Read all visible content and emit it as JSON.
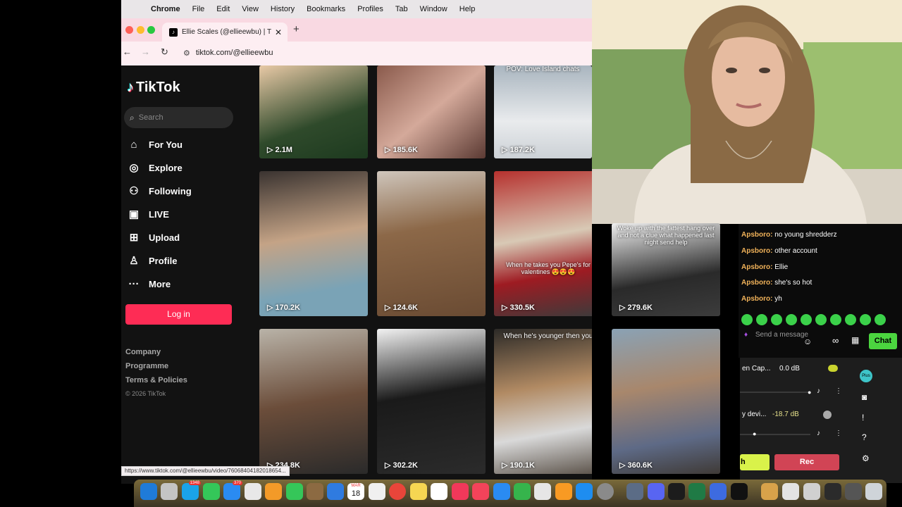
{
  "menubar": {
    "items": [
      "Chrome",
      "File",
      "Edit",
      "View",
      "History",
      "Bookmarks",
      "Profiles",
      "Tab",
      "Window",
      "Help"
    ]
  },
  "browser": {
    "tab_title": "Ellie Scales (@ellieewbu) | T",
    "url": "tiktok.com/@ellieewbu",
    "status_url": "https://www.tiktok.com/@ellieewbu/video/76068404182018654..."
  },
  "tiktok": {
    "logo": "TikTok",
    "search_placeholder": "Search",
    "nav": [
      {
        "label": "For You",
        "icon": "home-icon"
      },
      {
        "label": "Explore",
        "icon": "compass-icon"
      },
      {
        "label": "Following",
        "icon": "following-icon"
      },
      {
        "label": "LIVE",
        "icon": "live-icon"
      },
      {
        "label": "Upload",
        "icon": "upload-icon"
      },
      {
        "label": "Profile",
        "icon": "profile-icon"
      },
      {
        "label": "More",
        "icon": "more-icon"
      }
    ],
    "login_label": "Log in",
    "footer": [
      "Company",
      "Programme",
      "Terms & Policies"
    ],
    "copyright": "© 2026 TikTok",
    "videos": [
      {
        "views": "2.1M",
        "caption": ""
      },
      {
        "views": "185.6K",
        "caption": ""
      },
      {
        "views": "187.2K",
        "caption": "POV: Love Island chats"
      },
      {
        "views": "170.2K",
        "caption": ""
      },
      {
        "views": "124.6K",
        "caption": ""
      },
      {
        "views": "330.5K",
        "caption": "When he takes you Pepe's for valentines 😍😍😍"
      },
      {
        "views": "279.6K",
        "caption": "Woke up with the fattest hang over and not a clue what happened last night send help"
      },
      {
        "views": "234.8K",
        "caption": ""
      },
      {
        "views": "302.2K",
        "caption": ""
      },
      {
        "views": "190.1K",
        "caption": "When he's younger then you"
      },
      {
        "views": "360.6K",
        "caption": ""
      }
    ]
  },
  "chat": {
    "messages": [
      {
        "user": "Apsboro:",
        "text": "no young shredderz"
      },
      {
        "user": "Apsboro:",
        "text": "other account"
      },
      {
        "user": "Apsboro:",
        "text": "Ellie"
      },
      {
        "user": "Apsboro:",
        "text": "she's so hot"
      },
      {
        "user": "Apsboro:",
        "text": "yh"
      }
    ],
    "input_placeholder": "Send a message",
    "chat_button": "Chat"
  },
  "mixer": {
    "source1_name": "en Cap...",
    "source1_level": "0.0 dB",
    "source2_name": "y devi...",
    "source2_level": "-18.7 dB",
    "plus_badge": "Plus",
    "stream_label": "h",
    "rec_label": "Rec"
  },
  "dock": {
    "calendar_month": "MAR",
    "calendar_day": "18",
    "badge_a": "1348",
    "badge_b": "370"
  },
  "colors": {
    "tiktok_bg": "#121212",
    "login_accent": "#fe2c55",
    "chat_user": "#f2b35a",
    "chat_button": "#4bd53f",
    "rec_button": "#d14455"
  }
}
